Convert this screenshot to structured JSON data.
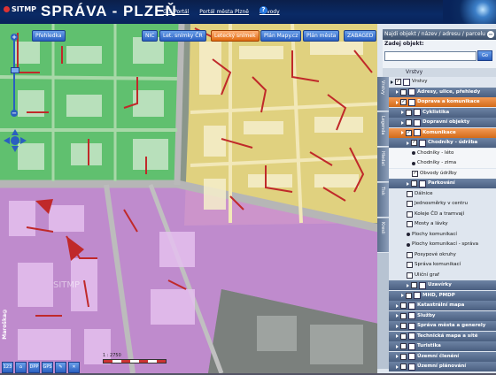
{
  "header": {
    "logo": "SITMP",
    "title": "SPRÁVA - PLZEŇ",
    "links": [
      "GIS Portál",
      "Portál města Plzně",
      "Návody"
    ],
    "help": "?"
  },
  "map": {
    "top_buttons": [
      {
        "label": "Přehledka",
        "active": false
      },
      {
        "label": "NIC",
        "active": false
      },
      {
        "label": "Let. snímky ČR",
        "active": false
      },
      {
        "label": "Letecký snímek",
        "active": true
      },
      {
        "label": "Plán Mapy.cz",
        "active": false
      },
      {
        "label": "Plán města",
        "active": false
      },
      {
        "label": "ZABAGED",
        "active": false
      }
    ],
    "zoom_in": "+",
    "zoom_out": "−",
    "vertical_text": "Maroška©",
    "scale_text": "1 : 2750",
    "tools": [
      "123",
      "⌂",
      "DPP",
      "GPS",
      "✎",
      "✕"
    ],
    "watermark": "SITMP",
    "colors": {
      "green": "#58c86a",
      "yellow": "#e9d77d",
      "purple": "#c88ad8",
      "road_red": "#c0292a"
    }
  },
  "panel": {
    "search_title": "Najdi objekt / název / adresu / parcelu",
    "search_label": "Zadej objekt:",
    "search_value": "",
    "go": "Go",
    "layers_title": "Vrstvy",
    "tabs": [
      "Vrstvy",
      "Legenda",
      "Hledat",
      "Tisk",
      "Kresli"
    ],
    "tree": [
      {
        "label": "Vrstvy",
        "style": "plain",
        "indent": 0,
        "type": "root"
      },
      {
        "label": "Adresy, ulice, přehledy",
        "style": "group",
        "indent": 1
      },
      {
        "label": "Doprava a komunikace",
        "style": "orange",
        "indent": 1,
        "checked": true
      },
      {
        "label": "Cyklistika",
        "style": "group",
        "indent": 2
      },
      {
        "label": "Dopravní objekty",
        "style": "group",
        "indent": 2
      },
      {
        "label": "Komunikace",
        "style": "orange",
        "indent": 2,
        "checked": true
      },
      {
        "label": "Chodníky - údržba",
        "style": "group",
        "indent": 3,
        "checked": true
      },
      {
        "label": "Chodníky - léto",
        "style": "sub",
        "indent": 4,
        "bullet": "dot"
      },
      {
        "label": "Chodníky - zima",
        "style": "sub",
        "indent": 4,
        "bullet": "dot"
      },
      {
        "label": "Obvody údržby",
        "style": "sub",
        "indent": 4,
        "checked": true
      },
      {
        "label": "Parkování",
        "style": "group",
        "indent": 3
      },
      {
        "label": "Dálnice",
        "style": "plain",
        "indent": 3,
        "bullet": "chk"
      },
      {
        "label": "Jednosměrky v centru",
        "style": "plain",
        "indent": 3,
        "bullet": "chk"
      },
      {
        "label": "Koleje ČD a tramvají",
        "style": "plain",
        "indent": 3,
        "bullet": "chk"
      },
      {
        "label": "Mosty a lávky",
        "style": "plain",
        "indent": 3,
        "bullet": "chk"
      },
      {
        "label": "Plochy komunikací",
        "style": "plain",
        "indent": 3,
        "bullet": "dot"
      },
      {
        "label": "Plochy komunikací - správa",
        "style": "plain",
        "indent": 3,
        "bullet": "dot"
      },
      {
        "label": "Posypové okruhy",
        "style": "plain",
        "indent": 3,
        "bullet": "chk"
      },
      {
        "label": "Správa komunikací",
        "style": "plain",
        "indent": 3,
        "bullet": "chk"
      },
      {
        "label": "Uliční graf",
        "style": "plain",
        "indent": 3,
        "bullet": "chk"
      },
      {
        "label": "Uzavírky",
        "style": "group",
        "indent": 3
      },
      {
        "label": "MHD, PMDP",
        "style": "group",
        "indent": 2
      },
      {
        "label": "Katastrální mapa",
        "style": "group",
        "indent": 1
      },
      {
        "label": "Služby",
        "style": "group",
        "indent": 1
      },
      {
        "label": "Správa města a generely",
        "style": "group",
        "indent": 1
      },
      {
        "label": "Technická mapa a sítě",
        "style": "group",
        "indent": 1
      },
      {
        "label": "Turistika",
        "style": "group",
        "indent": 1
      },
      {
        "label": "Územní členění",
        "style": "group",
        "indent": 1
      },
      {
        "label": "Územní plánování",
        "style": "group",
        "indent": 1
      }
    ]
  }
}
